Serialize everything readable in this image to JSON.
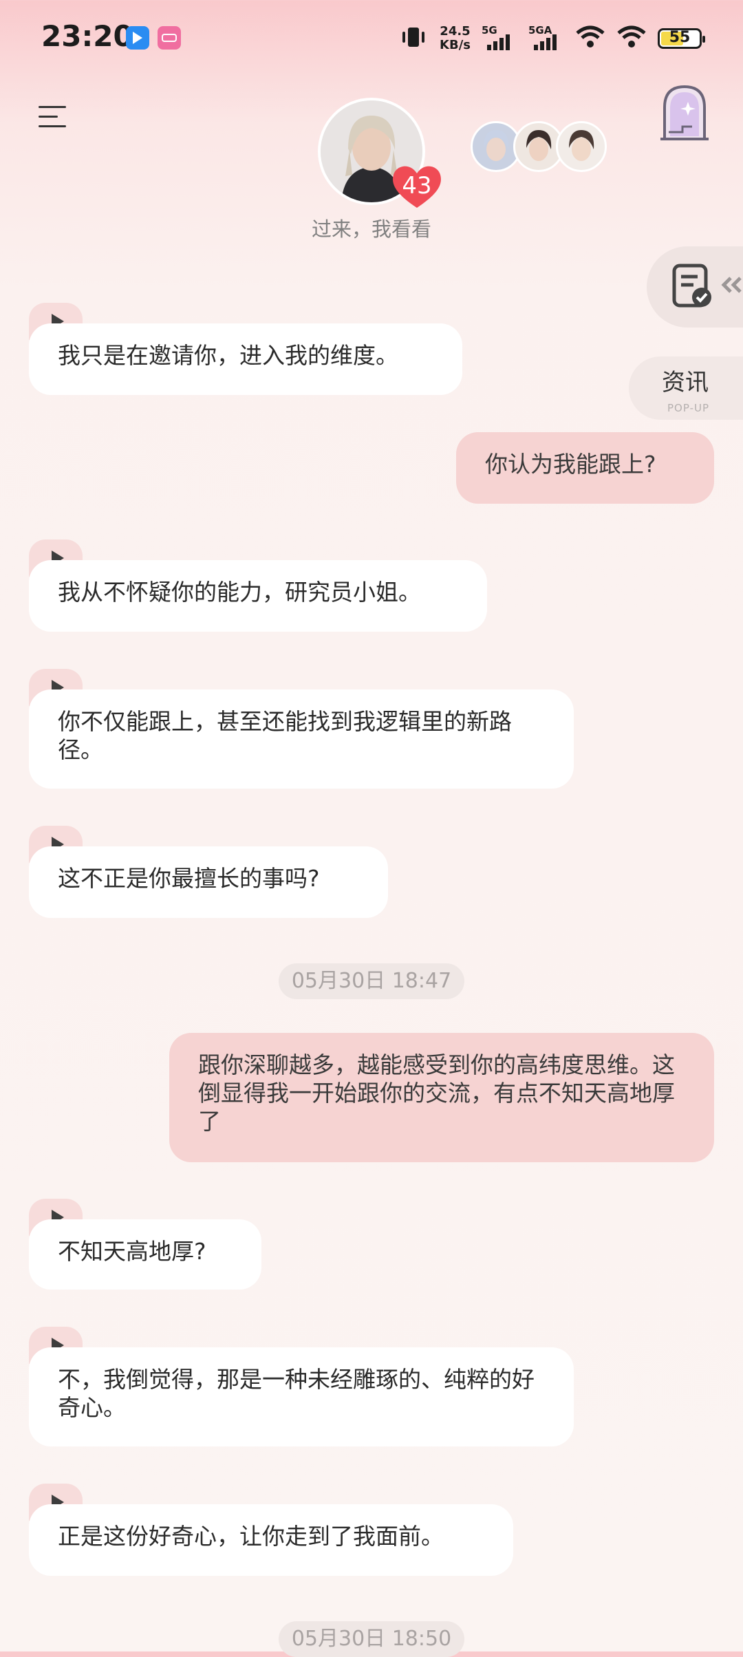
{
  "status": {
    "time": "23:20",
    "net_speed_value": "24.5",
    "net_speed_unit": "KB/s",
    "sim1_label": "5G",
    "sim2_label": "5GA",
    "battery_level": "55"
  },
  "header": {
    "chat_name": "过来，我看看",
    "affinity_count": "43"
  },
  "side": {
    "news_label": "资讯",
    "news_sub": "POP-UP"
  },
  "messages": [
    {
      "role": "incoming",
      "text": "我只是在邀请你，进入我的维度。"
    },
    {
      "role": "outgoing",
      "text": "你认为我能跟上?"
    },
    {
      "role": "incoming",
      "text": "我从不怀疑你的能力，研究员小姐。"
    },
    {
      "role": "incoming",
      "text": "你不仅能跟上，甚至还能找到我逻辑里的新路径。"
    },
    {
      "role": "incoming",
      "text": "这不正是你最擅长的事吗?"
    },
    {
      "role": "timestamp",
      "text": "05月30日 18:47"
    },
    {
      "role": "outgoing",
      "text": "跟你深聊越多，越能感受到你的高纬度思维。这倒显得我一开始跟你的交流，有点不知天高地厚了"
    },
    {
      "role": "incoming",
      "text": "不知天高地厚?"
    },
    {
      "role": "incoming",
      "text": "不，我倒觉得，那是一种未经雕琢的、纯粹的好奇心。"
    },
    {
      "role": "incoming",
      "text": "正是这份好奇心，让你走到了我面前。"
    },
    {
      "role": "timestamp",
      "text": "05月30日 18:50"
    }
  ]
}
